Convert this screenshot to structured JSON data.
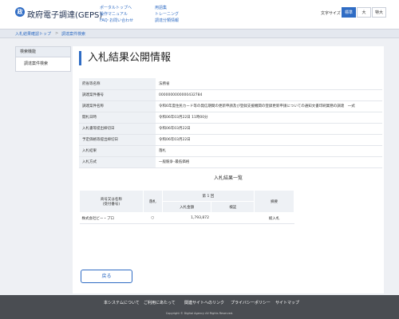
{
  "header": {
    "logo_glyph": "政",
    "title": "政府電子調達(GEPS)",
    "links": [
      "ポータルトップへ",
      "操作マニュアル",
      "FAQ･お問い合わせ",
      "用語集",
      "トレーニング",
      "調達分類情報"
    ],
    "font_size_label": "文字サイズ",
    "font_sizes": [
      "標準",
      "大",
      "特大"
    ],
    "active_font_size": "標準"
  },
  "breadcrumb": {
    "items": [
      "入札結果確認トップ",
      "調達案件検索"
    ],
    "separator": ">"
  },
  "sidebar": {
    "heading": "検索機能",
    "items": [
      "調達案件検索"
    ]
  },
  "main": {
    "title": "入札結果公開情報",
    "info_rows": [
      {
        "label": "府省等名称",
        "value": "法務省"
      },
      {
        "label": "調達案件番号",
        "value": "0000000000000432784"
      },
      {
        "label": "調達案件名称",
        "value": "令和6年度住民カード等の発信期間の更新申請及び登録支援機関の登録更新申請についての通知文書印刷業務の調達　一式"
      },
      {
        "label": "開札日時",
        "value": "令和06年03月22日 11時00分"
      },
      {
        "label": "入札書等提出締切日",
        "value": "令和06年03月22日"
      },
      {
        "label": "予定価格等提出締切日",
        "value": "令和06年03月22日"
      },
      {
        "label": "入札結果",
        "value": "落札"
      },
      {
        "label": "入札方式",
        "value": "一般競争･最低価格"
      }
    ],
    "result_caption": "入札結果一覧",
    "result_table": {
      "headers": {
        "vendor": "商号又は名称\n(受付番号)",
        "award": "落札",
        "round": "第 1 回",
        "amount": "入札金額",
        "verdict": "検証",
        "remarks": "摘要"
      },
      "rows": [
        {
          "vendor": "株式会社ビー・プロ",
          "award": "○",
          "amount": "1,793,872",
          "verdict": "",
          "remarks": "総入札"
        }
      ]
    },
    "back_label": "戻る"
  },
  "footer": {
    "links": [
      "本システムについて",
      "ご利用にあたって",
      "関連サイトへのリンク",
      "プライバシーポリシー",
      "サイトマップ"
    ],
    "copyright": "Copyright © Digital Agency All Rights Reserved."
  },
  "colors": {
    "accent": "#2f6cc4",
    "footer_bg": "#4a4d52",
    "page_bg": "#eef0f4"
  }
}
